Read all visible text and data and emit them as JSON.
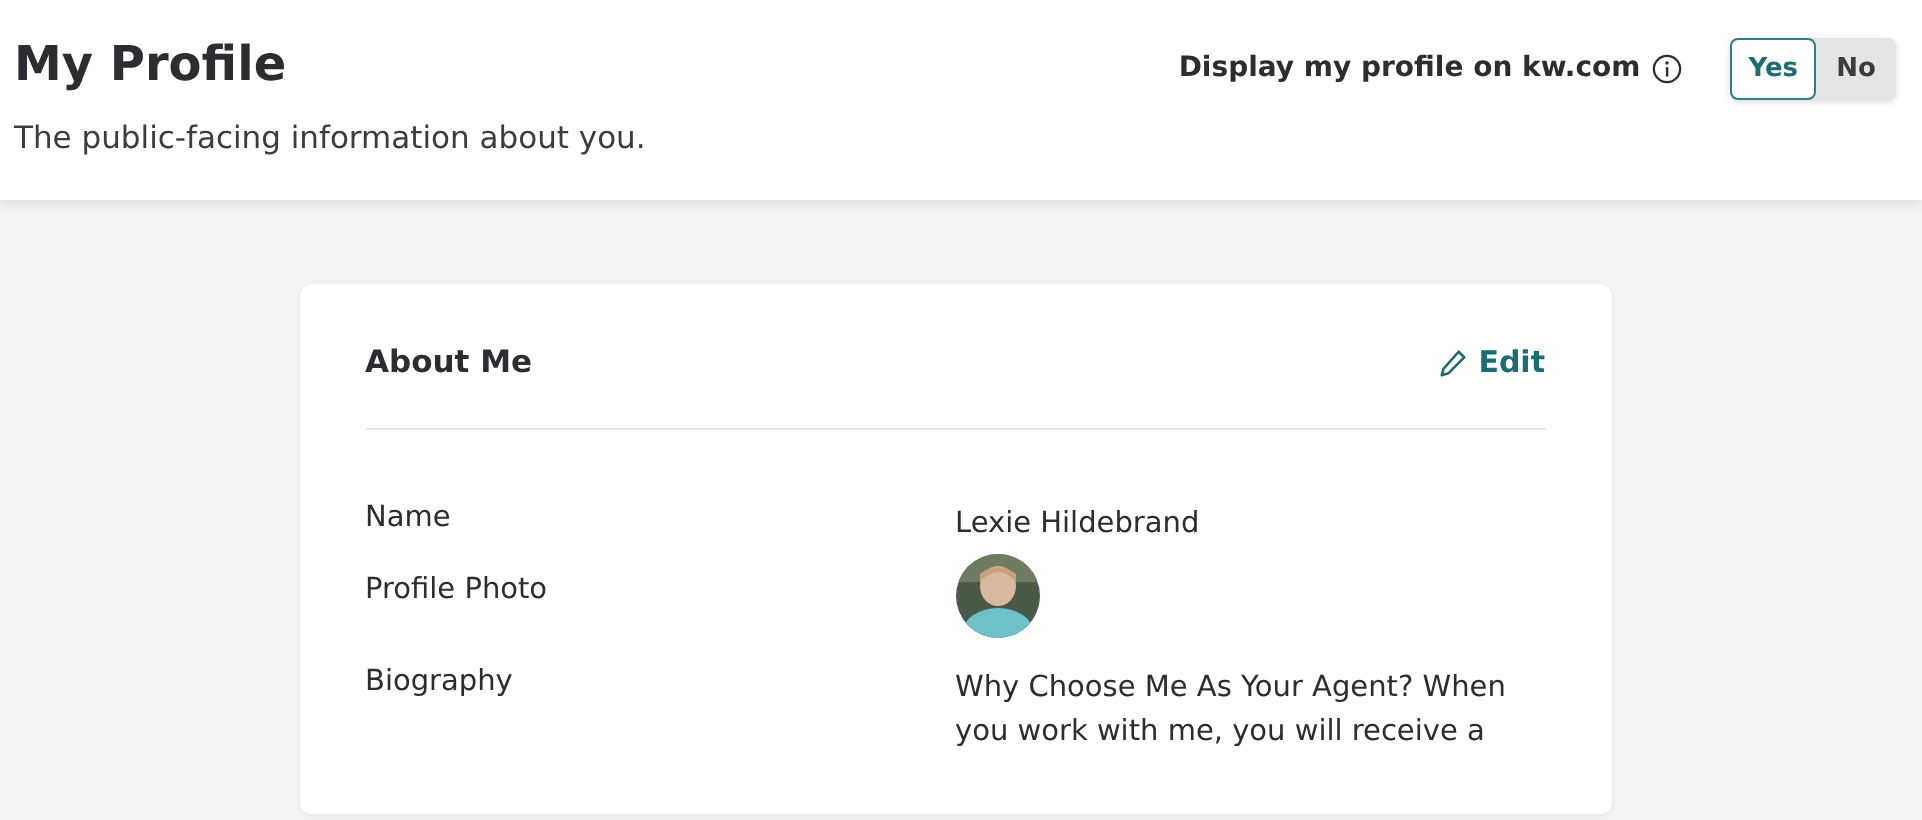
{
  "header": {
    "title": "My Profile",
    "subtitle": "The public-facing information about you.",
    "display_label": "Display my profile on kw.com",
    "toggle": [
      {
        "label": "Yes",
        "selected": true
      },
      {
        "label": "No",
        "selected": false
      }
    ]
  },
  "card": {
    "title": "About Me",
    "edit": "Edit",
    "fields": [
      {
        "label": "Name",
        "kind": "text",
        "value": "Lexie Hildebrand"
      },
      {
        "label": "Profile Photo"
      },
      {
        "label": "Biography",
        "kind": "text",
        "value": "Why Choose Me As Your Agent? When you work with me, you will receive a"
      }
    ]
  }
}
